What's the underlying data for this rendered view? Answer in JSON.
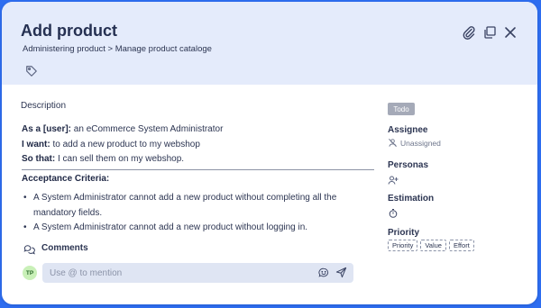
{
  "header": {
    "title": "Add product",
    "breadcrumb": "Administering product > Manage product cataloge",
    "icons": [
      "tag-icon",
      "paperclip-icon",
      "copy-icon",
      "close-icon"
    ]
  },
  "description": {
    "label": "Description",
    "story": [
      {
        "key": "As a [user]:",
        "value": "an eCommerce System Administrator"
      },
      {
        "key": "I want:",
        "value": "to add a new product to my webshop"
      },
      {
        "key": "So that:",
        "value": "I can sell them on my webshop."
      }
    ],
    "acceptance_title": "Acceptance Criteria:",
    "acceptance_items": [
      "A System Administrator cannot add a new product without completing all the mandatory fields.",
      "A System Administrator cannot add a new product without logging in."
    ]
  },
  "comments": {
    "label": "Comments",
    "avatar_initials": "TP",
    "placeholder": "Use @ to mention"
  },
  "sidebar": {
    "status": "Todo",
    "assignee_label": "Assignee",
    "assignee_value": "Unassigned",
    "personas_label": "Personas",
    "estimation_label": "Estimation",
    "priority_label": "Priority",
    "priority_chips": [
      "Priority",
      "Value",
      "Effort"
    ]
  },
  "colors": {
    "background": "#2d6df0",
    "header_bg": "#e4ebfb",
    "badge_bg": "#a5aab8",
    "avatar_bg": "#c9f0b8"
  }
}
